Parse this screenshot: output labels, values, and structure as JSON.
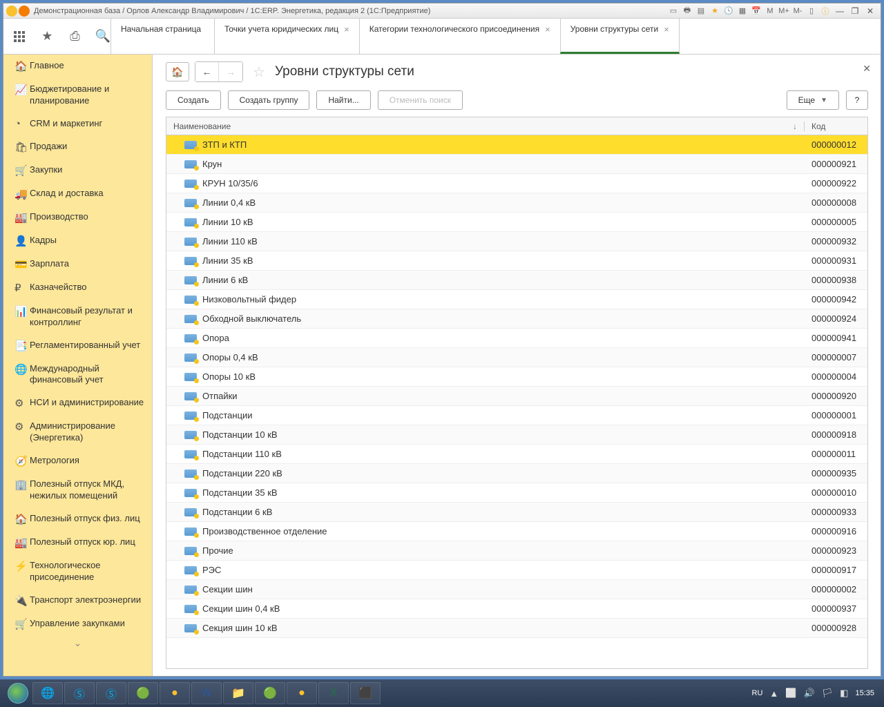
{
  "window_title": "Демонстрационная база / Орлов Александр Владимирович / 1С:ERP. Энергетика, редакция 2  (1С:Предприятие)",
  "titlebar_tools": {
    "m": "M",
    "mplus": "M+",
    "mminus": "M-"
  },
  "tabs": [
    {
      "label": "Начальная страница",
      "closable": false
    },
    {
      "label": "Точки учета юридических лиц",
      "closable": true
    },
    {
      "label": "Категории технологического присоединения",
      "closable": true
    },
    {
      "label": "Уровни структуры сети",
      "closable": true,
      "active": true
    }
  ],
  "sidebar": [
    {
      "icon": "🏠",
      "label": "Главное"
    },
    {
      "icon": "📈",
      "label": "Бюджетирование и планирование"
    },
    {
      "icon": "◔",
      "label": "CRM и маркетинг"
    },
    {
      "icon": "🛍",
      "label": "Продажи"
    },
    {
      "icon": "🛒",
      "label": "Закупки"
    },
    {
      "icon": "🚚",
      "label": "Склад и доставка"
    },
    {
      "icon": "🏭",
      "label": "Производство"
    },
    {
      "icon": "👤",
      "label": "Кадры"
    },
    {
      "icon": "💳",
      "label": "Зарплата"
    },
    {
      "icon": "₽",
      "label": "Казначейство"
    },
    {
      "icon": "📊",
      "label": "Финансовый результат и контроллинг"
    },
    {
      "icon": "📑",
      "label": "Регламентированный учет"
    },
    {
      "icon": "🌐",
      "label": "Международный финансовый учет"
    },
    {
      "icon": "⚙",
      "label": "НСИ и администрирование"
    },
    {
      "icon": "⚙",
      "label": "Администрирование (Энергетика)"
    },
    {
      "icon": "🧭",
      "label": "Метрология"
    },
    {
      "icon": "🏢",
      "label": "Полезный отпуск МКД, нежилых помещений"
    },
    {
      "icon": "🏠",
      "label": "Полезный отпуск физ. лиц"
    },
    {
      "icon": "🏭",
      "label": "Полезный отпуск юр. лиц"
    },
    {
      "icon": "⚡",
      "label": "Технологическое присоединение"
    },
    {
      "icon": "🔌",
      "label": "Транспорт электроэнергии"
    },
    {
      "icon": "🛒",
      "label": "Управление закупками"
    }
  ],
  "page": {
    "title": "Уровни структуры сети",
    "buttons": {
      "create": "Создать",
      "create_group": "Создать группу",
      "find": "Найти...",
      "cancel_find": "Отменить поиск",
      "more": "Еще",
      "help": "?"
    },
    "columns": {
      "name": "Наименование",
      "code": "Код"
    }
  },
  "rows": [
    {
      "name": "ЗТП и КТП",
      "code": "000000012",
      "selected": true
    },
    {
      "name": "Крун",
      "code": "000000921"
    },
    {
      "name": "КРУН 10/35/6",
      "code": "000000922"
    },
    {
      "name": "Линии 0,4 кВ",
      "code": "000000008"
    },
    {
      "name": "Линии 10 кВ",
      "code": "000000005"
    },
    {
      "name": "Линии 110 кВ",
      "code": "000000932"
    },
    {
      "name": "Линии 35 кВ",
      "code": "000000931"
    },
    {
      "name": "Линии 6 кВ",
      "code": "000000938"
    },
    {
      "name": "Низковольтный фидер",
      "code": "000000942"
    },
    {
      "name": "Обходной выключатель",
      "code": "000000924"
    },
    {
      "name": "Опора",
      "code": "000000941"
    },
    {
      "name": "Опоры 0,4 кВ",
      "code": "000000007"
    },
    {
      "name": "Опоры 10 кВ",
      "code": "000000004"
    },
    {
      "name": "Отпайки",
      "code": "000000920"
    },
    {
      "name": "Подстанции",
      "code": "000000001"
    },
    {
      "name": "Подстанции 10 кВ",
      "code": "000000918"
    },
    {
      "name": "Подстанции 110 кВ",
      "code": "000000011"
    },
    {
      "name": "Подстанции 220 кВ",
      "code": "000000935"
    },
    {
      "name": "Подстанции 35 кВ",
      "code": "000000010"
    },
    {
      "name": "Подстанции 6 кВ",
      "code": "000000933"
    },
    {
      "name": "Производственное отделение",
      "code": "000000916"
    },
    {
      "name": "Прочие",
      "code": "000000923"
    },
    {
      "name": "РЭС",
      "code": "000000917"
    },
    {
      "name": "Секции шин",
      "code": "000000002"
    },
    {
      "name": "Секции шин 0,4 кВ",
      "code": "000000937"
    },
    {
      "name": "Секция шин 10 кВ",
      "code": "000000928"
    }
  ],
  "taskbar": {
    "lang": "RU",
    "time": "15:35"
  }
}
